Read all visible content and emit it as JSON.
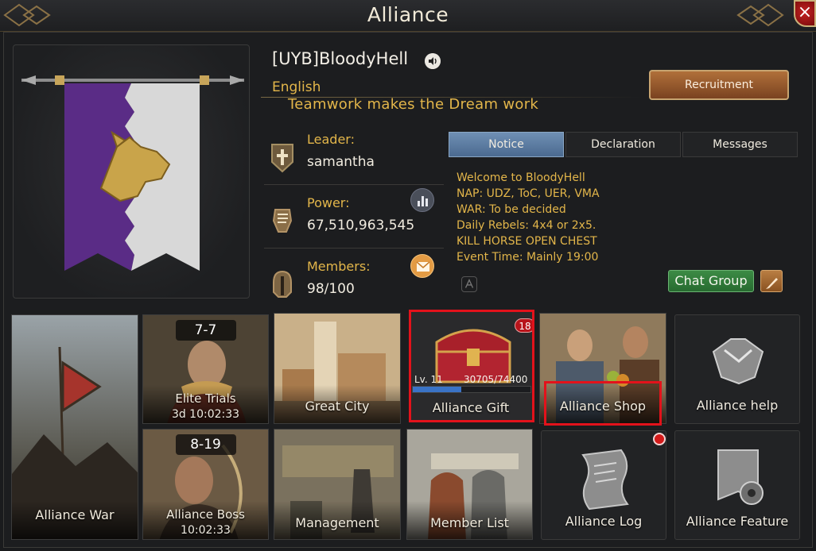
{
  "window": {
    "title": "Alliance",
    "close": "×"
  },
  "alliance": {
    "name": "[UYB]BloodyHell",
    "language": "English",
    "motto": "Teamwork makes the Dream work",
    "recruit_label": "Recruitment"
  },
  "stats": {
    "leader_label": "Leader:",
    "leader_value": "samantha",
    "power_label": "Power:",
    "power_value": "67,510,963,545",
    "members_label": "Members:",
    "members_value": "98/100"
  },
  "notice": {
    "tabs": [
      "Notice",
      "Declaration",
      "Messages"
    ],
    "active_tab": "Notice",
    "lines": [
      "Welcome to BloodyHell",
      "NAP: UDZ, ToC, UER, VMA",
      "WAR: To be decided",
      "Daily Rebels: 4x4 or 2x5.",
      "KILL HORSE OPEN CHEST",
      "Event Time: Mainly 19:00"
    ],
    "chat_group_label": "Chat Group"
  },
  "tiles": {
    "alliance_war": "Alliance War",
    "elite_trials": {
      "label": "Elite Trials",
      "stage": "7-7",
      "timer": "3d 10:02:33"
    },
    "great_city": "Great City",
    "alliance_gift": {
      "label": "Alliance Gift",
      "count": "18",
      "level": "Lv. 11",
      "progress_text": "30705/74400",
      "progress": 0.413
    },
    "alliance_shop": "Alliance Shop",
    "alliance_help": "Alliance help",
    "alliance_boss": {
      "label": "Alliance Boss",
      "stage": "8-19",
      "timer": "10:02:33"
    },
    "management": "Management",
    "member_list": "Member List",
    "alliance_log": "Alliance Log",
    "alliance_feature": "Alliance Feature"
  },
  "colors": {
    "accent_gold": "#e3b64a",
    "highlight_red": "#e3121b",
    "tab_active": "#5b7ca2"
  }
}
